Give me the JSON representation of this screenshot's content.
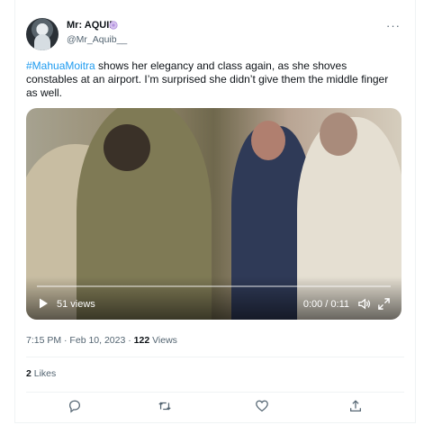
{
  "tweet": {
    "author_name": "Mr: AQUIB",
    "author_handle": "@Mr_Aquib__",
    "more_label": "···",
    "hashtag": "#MahuaMoitra",
    "body": " shows her elegancy and class again, as she shoves constables at an airport. I’m surprised she didn’t give them the middle finger as well.",
    "timestamp": "7:15 PM · Feb 10, 2023 · ",
    "views_count": "122",
    "views_label": " Views",
    "likes_count": "2",
    "likes_label": " Likes"
  },
  "video": {
    "views": "51 views",
    "time": "0:00 / 0:11",
    "progress": 0
  },
  "colors": {
    "accent": "#1d9bf0",
    "text": "#0f1419",
    "muted": "#536471",
    "border": "#eff3f4"
  },
  "icons": {
    "verified": "verified-badge-icon",
    "play": "play-icon",
    "volume": "volume-icon",
    "expand": "expand-icon",
    "reply": "reply-icon",
    "retweet": "retweet-icon",
    "like": "heart-icon",
    "share": "share-icon"
  }
}
